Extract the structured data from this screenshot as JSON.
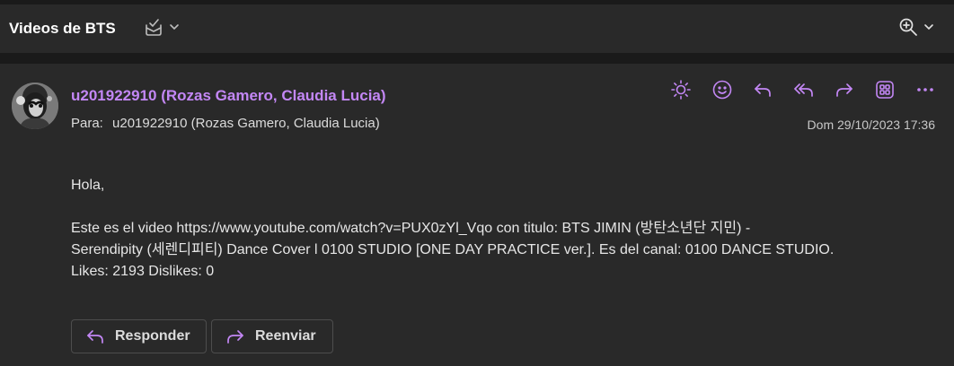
{
  "header": {
    "subject": "Videos de BTS",
    "icons": [
      "select-mail-icon",
      "chevron-down-icon",
      "zoom-icon",
      "chevron-down-icon"
    ]
  },
  "message": {
    "sender": "u201922910 (Rozas Gamero, Claudia Lucia)",
    "to_label": "Para:",
    "to_value": "u201922910 (Rozas Gamero, Claudia Lucia)",
    "date": "Dom 29/10/2023 17:36",
    "actions": [
      "brightness-icon",
      "emoji-icon",
      "reply-icon",
      "reply-all-icon",
      "forward-icon",
      "apps-icon",
      "more-icon"
    ],
    "body": {
      "greeting": "Hola,",
      "line1": "Este es el video https://www.youtube.com/watch?v=PUX0zYl_Vqo con titulo: BTS JIMIN (방탄소년단 지민) -",
      "line2": "Serendipity (세렌디피티) Dance Cover l 0100 STUDIO [ONE DAY PRACTICE ver.]. Es del canal: 0100 DANCE STUDIO.",
      "line3": "Likes: 2193 Dislikes: 0"
    },
    "reply_label": "Responder",
    "forward_label": "Reenviar"
  },
  "colors": {
    "accent": "#c387f5",
    "background": "#292929",
    "separator": "#1a1a1a"
  }
}
